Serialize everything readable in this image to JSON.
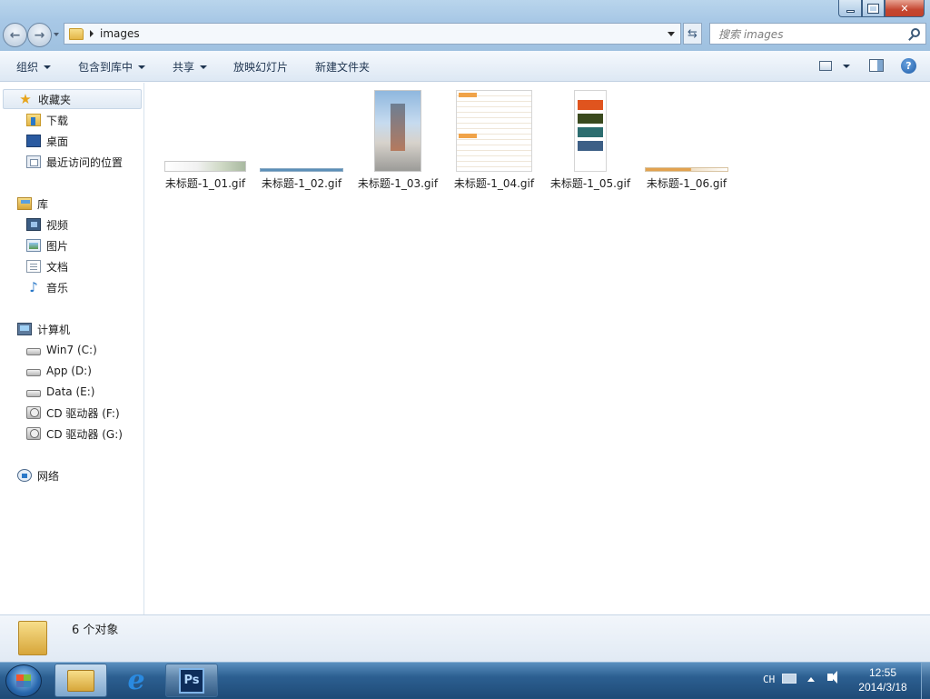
{
  "nav": {
    "breadcrumb": "images",
    "search_placeholder": "搜索 images"
  },
  "toolbar": {
    "organize": "组织",
    "include_in_library": "包含到库中",
    "share": "共享",
    "slideshow": "放映幻灯片",
    "new_folder": "新建文件夹"
  },
  "sidebar": {
    "favorites": {
      "label": "收藏夹",
      "items": [
        {
          "label": "下载"
        },
        {
          "label": "桌面"
        },
        {
          "label": "最近访问的位置"
        }
      ]
    },
    "libraries": {
      "label": "库",
      "items": [
        {
          "label": "视频"
        },
        {
          "label": "图片"
        },
        {
          "label": "文档"
        },
        {
          "label": "音乐"
        }
      ]
    },
    "computer": {
      "label": "计算机",
      "items": [
        {
          "label": "Win7 (C:)"
        },
        {
          "label": "App (D:)"
        },
        {
          "label": "Data (E:)"
        },
        {
          "label": "CD 驱动器 (F:)"
        },
        {
          "label": "CD 驱动器 (G:)"
        }
      ]
    },
    "network": {
      "label": "网络"
    }
  },
  "files": [
    {
      "name": "未标题-1_01.gif"
    },
    {
      "name": "未标题-1_02.gif"
    },
    {
      "name": "未标题-1_03.gif"
    },
    {
      "name": "未标题-1_04.gif"
    },
    {
      "name": "未标题-1_05.gif"
    },
    {
      "name": "未标题-1_06.gif"
    }
  ],
  "status": {
    "count": "6 个对象"
  },
  "taskbar": {
    "tray_lang": "CH",
    "time": "12:55",
    "date": "2014/3/18",
    "ps_label": "Ps"
  }
}
